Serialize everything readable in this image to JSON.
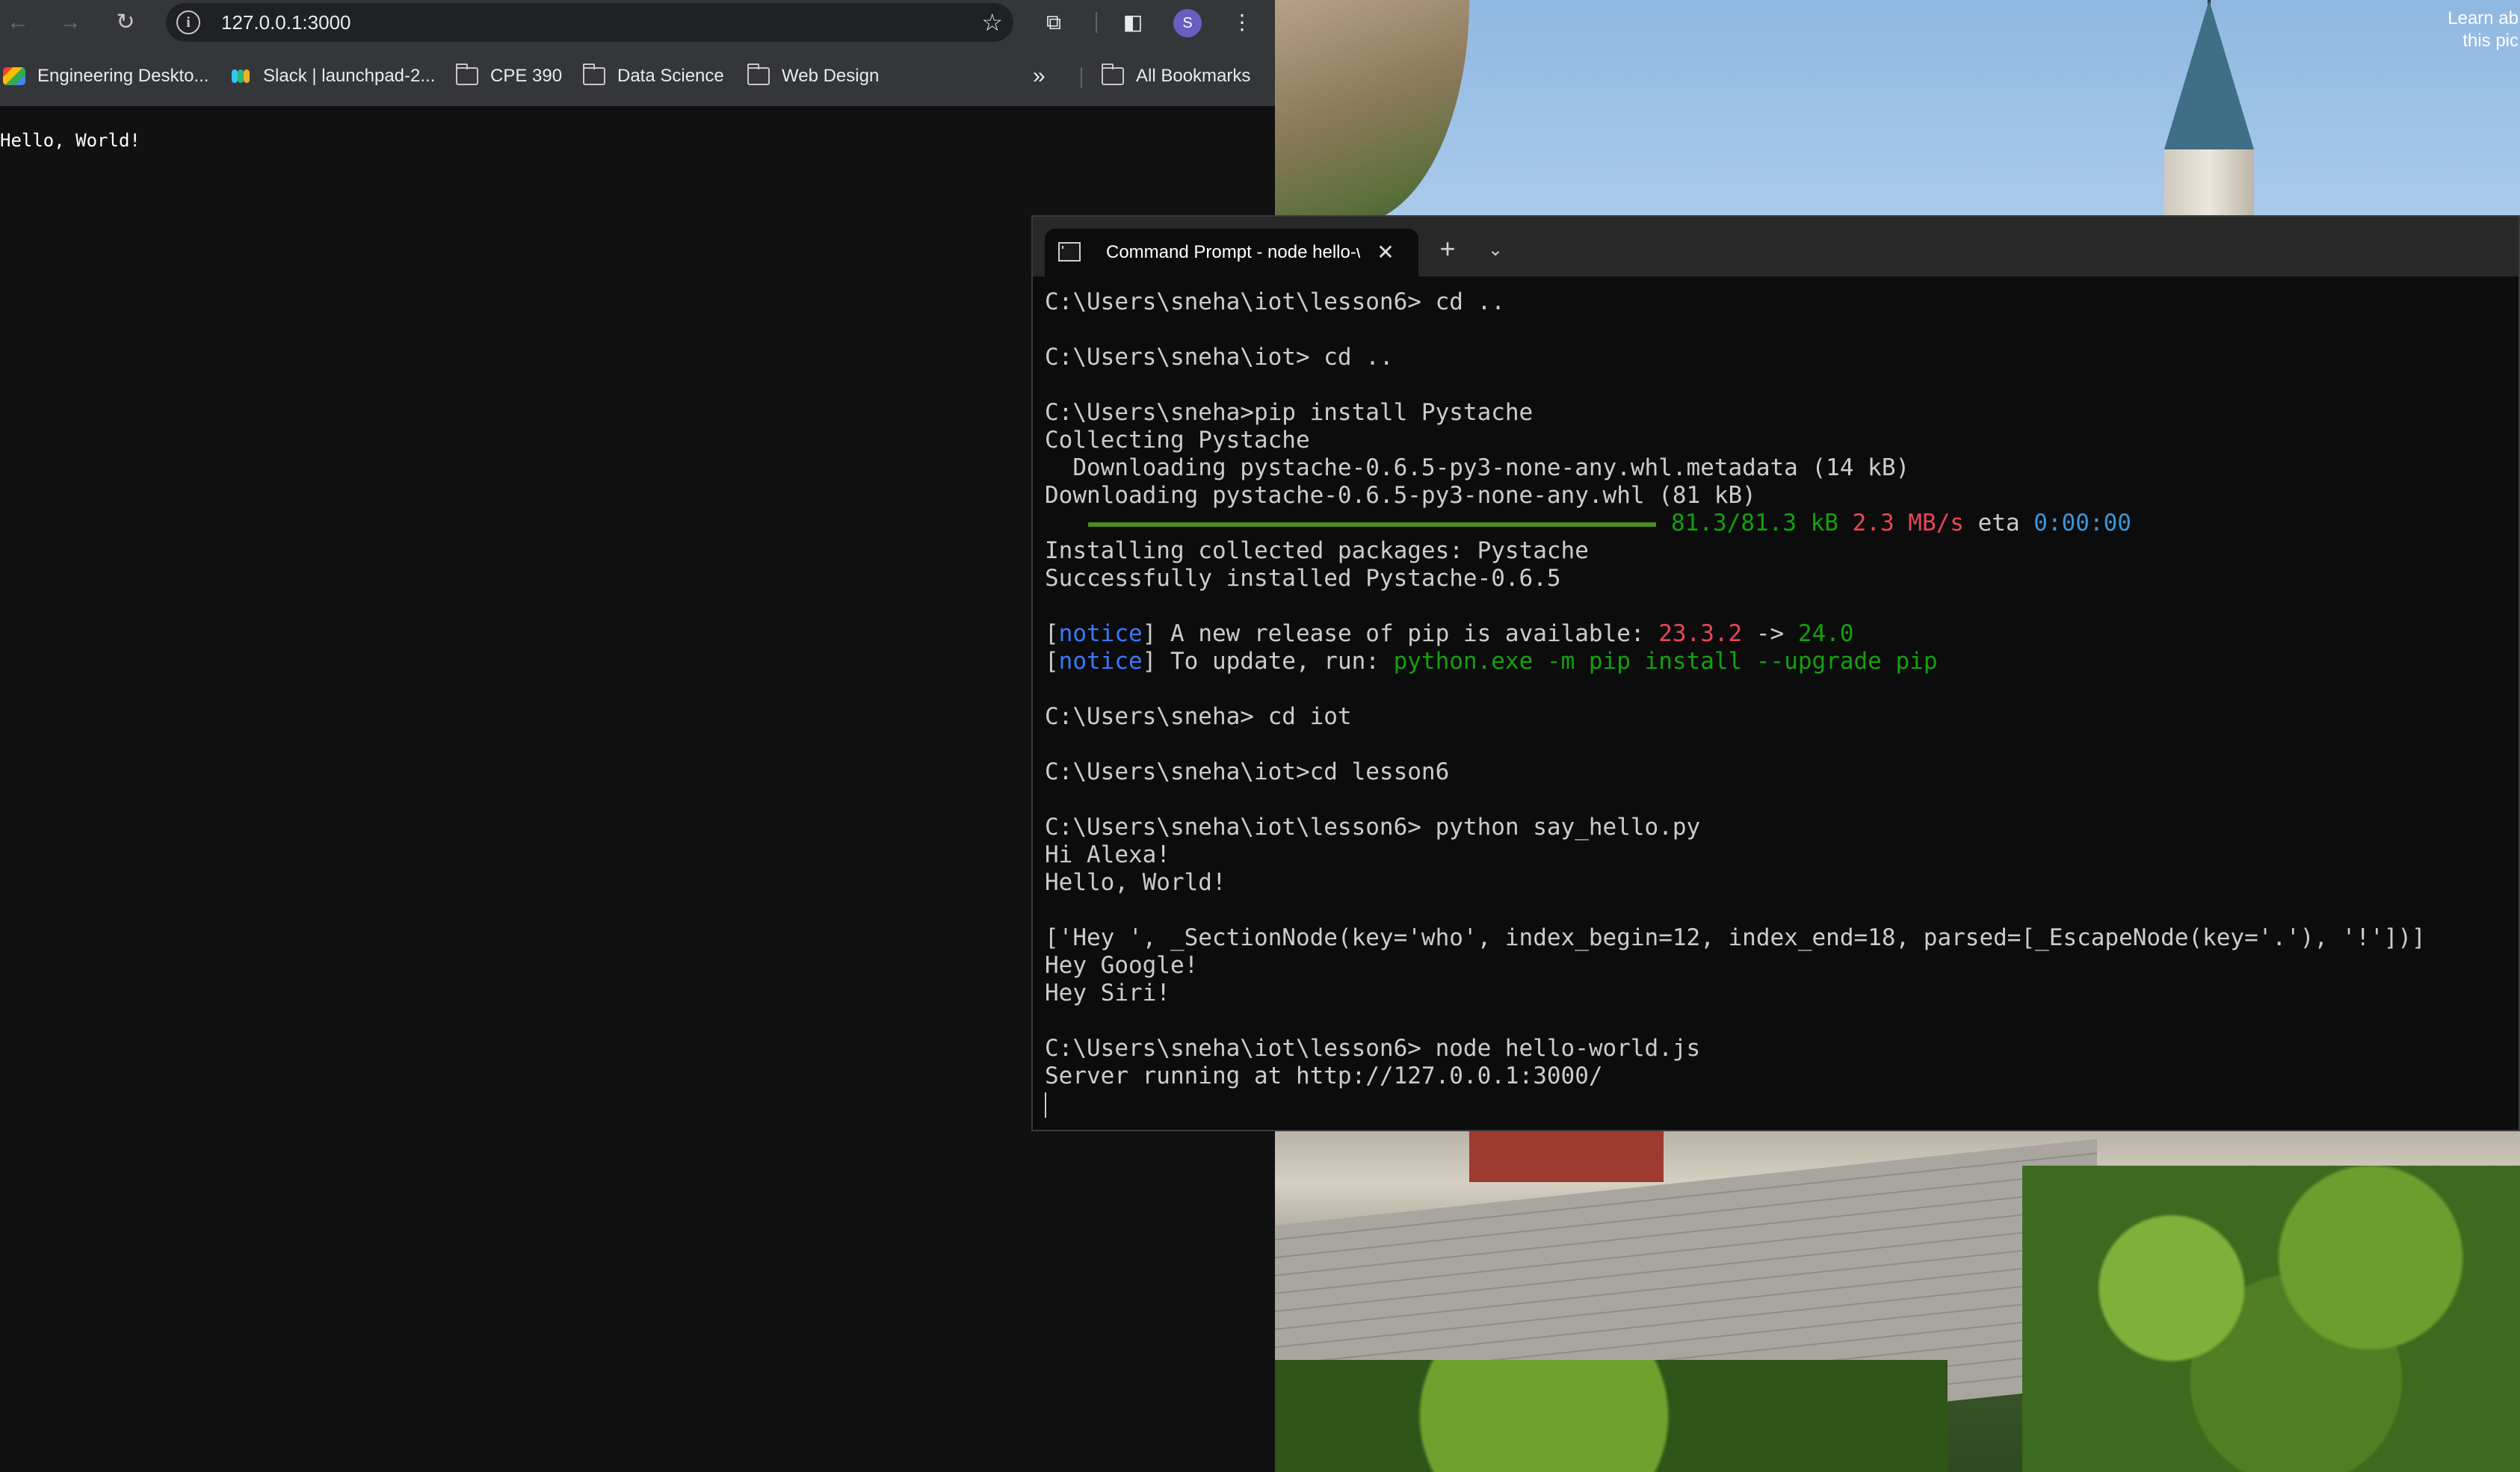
{
  "browser": {
    "url": "127.0.0.1:3000",
    "profile_initial": "S",
    "icons": {
      "back": "arrow-left-icon",
      "forward": "arrow-right-icon",
      "reload": "reload-icon",
      "site_info": "info-icon",
      "bookmark_star": "star-icon",
      "extensions": "puzzle-icon",
      "side_panel": "side-panel-icon",
      "menu": "kebab-menu-icon"
    },
    "bookmarks": [
      {
        "label": "Engineering Deskto...",
        "icon": "app-icon"
      },
      {
        "label": "Slack | launchpad-2...",
        "icon": "slack-icon"
      },
      {
        "label": "CPE 390",
        "icon": "folder-icon"
      },
      {
        "label": "Data Science",
        "icon": "folder-icon"
      },
      {
        "label": "Web Design",
        "icon": "folder-icon"
      }
    ],
    "overflow": "»",
    "all_bookmarks": "All Bookmarks",
    "page_text": "Hello, World!"
  },
  "desktop": {
    "corner_text_1": "Learn ab",
    "corner_text_2": "this pic"
  },
  "terminal": {
    "tab_title": "Command Prompt - node hello-world.js",
    "lines": [
      "C:\\Users\\sneha\\iot\\lesson6> cd ..",
      "",
      "C:\\Users\\sneha\\iot> cd ..",
      "",
      "C:\\Users\\sneha>pip install Pystache",
      "Collecting Pystache",
      "  Downloading pystache-0.6.5-py3-none-any.whl.metadata (14 kB)",
      "Downloading pystache-0.6.5-py3-none-any.whl (81 kB)"
    ],
    "progress": {
      "fraction": 1.0,
      "size": "81.3/81.3 kB",
      "speed": "2.3 MB/s",
      "eta_label": "eta",
      "eta": "0:00:00"
    },
    "lines2": [
      "Installing collected packages: Pystache",
      "Successfully installed Pystache-0.6.5",
      ""
    ],
    "notice1": {
      "tag": "notice",
      "text": " A new release of pip is available: ",
      "old": "23.3.2",
      "arrow": " -> ",
      "new": "24.0"
    },
    "notice2": {
      "tag": "notice",
      "text": " To update, run: ",
      "cmd": "python.exe -m pip install --upgrade pip"
    },
    "lines3": [
      "",
      "C:\\Users\\sneha> cd iot",
      "",
      "C:\\Users\\sneha\\iot>cd lesson6",
      "",
      "C:\\Users\\sneha\\iot\\lesson6> python say_hello.py",
      "Hi Alexa!",
      "Hello, World!",
      "",
      "['Hey ', _SectionNode(key='who', index_begin=12, index_end=18, parsed=[_EscapeNode(key='.'), '!'])]",
      "Hey Google!",
      "Hey Siri!",
      "",
      "C:\\Users\\sneha\\iot\\lesson6> node hello-world.js",
      "Server running at http://127.0.0.1:3000/"
    ],
    "colors": {
      "green": "#13a10e",
      "red": "#e74856",
      "blue": "#3b78ff",
      "cyan": "#3a96dd"
    }
  }
}
